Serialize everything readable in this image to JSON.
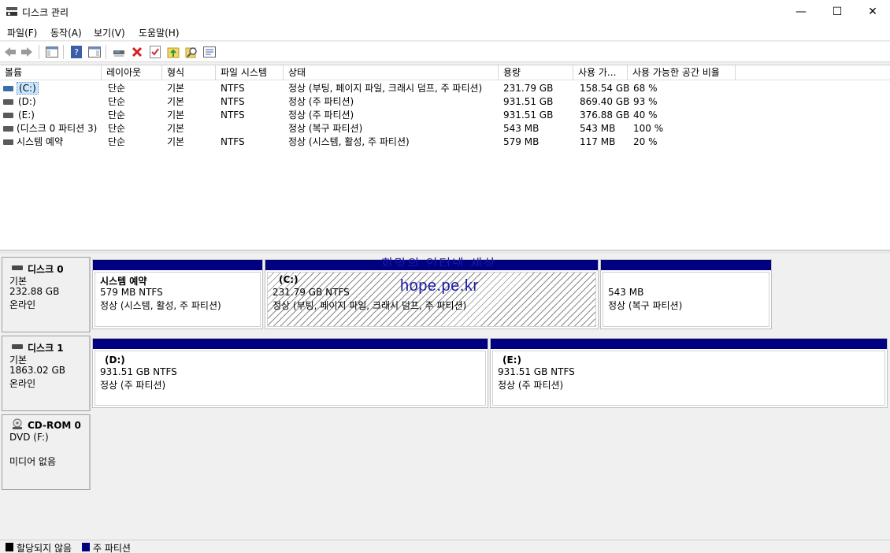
{
  "window": {
    "title": "디스크 관리",
    "minimize": "—",
    "maximize": "☐",
    "close": "✕"
  },
  "menu": [
    "파일(F)",
    "동작(A)",
    "보기(V)",
    "도움말(H)"
  ],
  "toolbar": {
    "icons": [
      "back-icon",
      "forward-icon",
      "show-hide-console-tree-icon",
      "help-icon",
      "show-hide-action-pane-icon",
      "connect-drive-icon",
      "delete-icon",
      "check-icon",
      "import-icon",
      "search-icon",
      "properties-icon"
    ]
  },
  "volumes": {
    "headers": [
      "볼륨",
      "레이아웃",
      "형식",
      "파일 시스템",
      "상태",
      "용량",
      "사용 가...",
      "사용 가능한 공간 비율"
    ],
    "rows": [
      {
        "name": "(C:)",
        "layout": "단순",
        "type": "기본",
        "fs": "NTFS",
        "status": "정상 (부팅, 페이지 파일, 크래시 덤프, 주 파티션)",
        "capacity": "231.79 GB",
        "free": "158.54 GB",
        "pct": "68 %"
      },
      {
        "name": "(D:)",
        "layout": "단순",
        "type": "기본",
        "fs": "NTFS",
        "status": "정상 (주 파티션)",
        "capacity": "931.51 GB",
        "free": "869.40 GB",
        "pct": "93 %"
      },
      {
        "name": "(E:)",
        "layout": "단순",
        "type": "기본",
        "fs": "NTFS",
        "status": "정상 (주 파티션)",
        "capacity": "931.51 GB",
        "free": "376.88 GB",
        "pct": "40 %"
      },
      {
        "name": "(디스크 0 파티션 3)",
        "layout": "단순",
        "type": "기본",
        "fs": "",
        "status": "정상 (복구 파티션)",
        "capacity": "543 MB",
        "free": "543 MB",
        "pct": "100 %"
      },
      {
        "name": "시스템 예약",
        "layout": "단순",
        "type": "기본",
        "fs": "NTFS",
        "status": "정상 (시스템, 활성, 주 파티션)",
        "capacity": "579 MB",
        "free": "117 MB",
        "pct": "20 %"
      }
    ]
  },
  "disks": [
    {
      "name": "디스크 0",
      "type": "기본",
      "size": "232.88 GB",
      "state": "온라인",
      "partitions": [
        {
          "title": "시스템 예약",
          "line1": "579 MB NTFS",
          "line2": "정상 (시스템, 활성, 주 파티션)"
        },
        {
          "title": "(C:)",
          "line1": "231.79 GB NTFS",
          "line2": "정상 (부팅, 페이지 파일, 크래시 덤프, 주 파티션)"
        },
        {
          "title": "",
          "line1": "543 MB",
          "line2": "정상 (복구 파티션)"
        }
      ]
    },
    {
      "name": "디스크 1",
      "type": "기본",
      "size": "1863.02 GB",
      "state": "온라인",
      "partitions": [
        {
          "title": "(D:)",
          "line1": "931.51 GB NTFS",
          "line2": "정상 (주 파티션)"
        },
        {
          "title": "(E:)",
          "line1": "931.51 GB NTFS",
          "line2": "정상 (주 파티션)"
        }
      ]
    },
    {
      "name": "CD-ROM 0",
      "type": "DVD (F:)",
      "size": "",
      "state": "미디어 없음"
    }
  ],
  "watermark": {
    "url": "hope.pe.kr",
    "top": "희망의 인터넷 세상"
  },
  "legend": {
    "unallocated": "할당되지 않음",
    "primary": "주 파티션",
    "unallocated_color": "#000000",
    "primary_color": "#000080"
  }
}
